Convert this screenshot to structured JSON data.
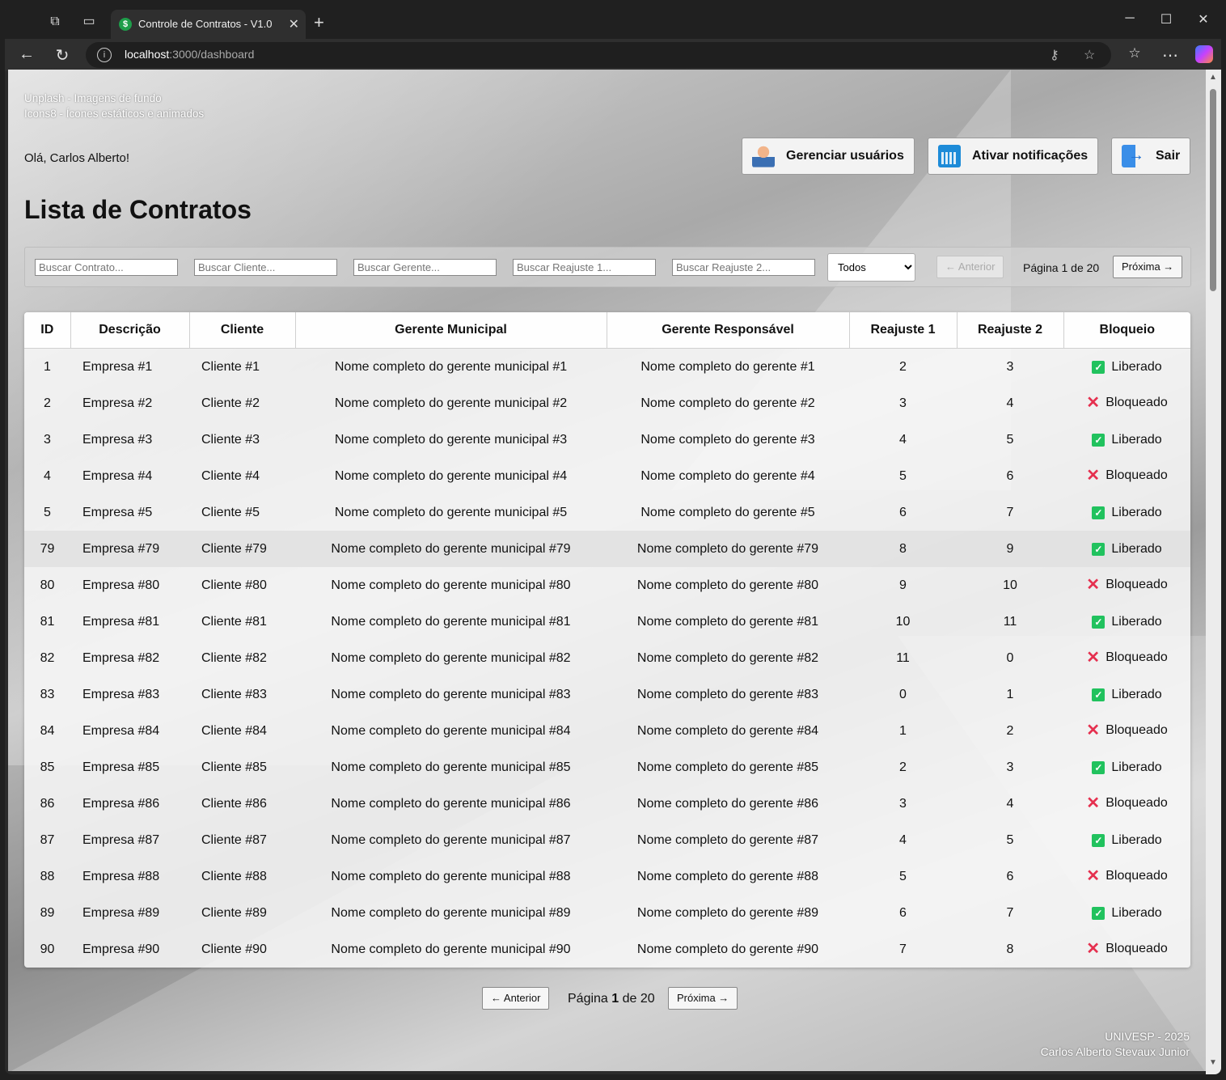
{
  "browser": {
    "tab_title": "Controle de Contratos - V1.0",
    "tab_favicon": "$",
    "url_host": "localhost",
    "url_path": ":3000/dashboard"
  },
  "credits": {
    "line1": "Unplash - Imagens de fundo",
    "line2": "Icons8 - Ícones estáticos e animados"
  },
  "greeting": "Olá, Carlos Alberto!",
  "header_buttons": {
    "users": "Gerenciar usuários",
    "notifications": "Ativar notificações",
    "logout": "Sair"
  },
  "page_title": "Lista de Contratos",
  "filters": {
    "contrato_placeholder": "Buscar Contrato...",
    "cliente_placeholder": "Buscar Cliente...",
    "gerente_placeholder": "Buscar Gerente...",
    "reajuste1_placeholder": "Buscar Reajuste 1...",
    "reajuste2_placeholder": "Buscar Reajuste 2...",
    "status_selected": "Todos"
  },
  "pagination": {
    "prev": "← Anterior",
    "next": "Próxima →",
    "label_prefix": "Página",
    "current": "1",
    "label_mid": "de",
    "total": "20",
    "text": "Página 1 de 20"
  },
  "table": {
    "headers": [
      "ID",
      "Descrição",
      "Cliente",
      "Gerente Municipal",
      "Gerente Responsável",
      "Reajuste 1",
      "Reajuste 2",
      "Bloqueio"
    ],
    "rows": [
      {
        "id": "1",
        "desc": "Empresa #1",
        "cliente": "Cliente #1",
        "gm": "Nome completo do gerente municipal #1",
        "gr": "Nome completo do gerente #1",
        "r1": "2",
        "r2": "3",
        "status": "Liberado"
      },
      {
        "id": "2",
        "desc": "Empresa #2",
        "cliente": "Cliente #2",
        "gm": "Nome completo do gerente municipal #2",
        "gr": "Nome completo do gerente #2",
        "r1": "3",
        "r2": "4",
        "status": "Bloqueado"
      },
      {
        "id": "3",
        "desc": "Empresa #3",
        "cliente": "Cliente #3",
        "gm": "Nome completo do gerente municipal #3",
        "gr": "Nome completo do gerente #3",
        "r1": "4",
        "r2": "5",
        "status": "Liberado"
      },
      {
        "id": "4",
        "desc": "Empresa #4",
        "cliente": "Cliente #4",
        "gm": "Nome completo do gerente municipal #4",
        "gr": "Nome completo do gerente #4",
        "r1": "5",
        "r2": "6",
        "status": "Bloqueado"
      },
      {
        "id": "5",
        "desc": "Empresa #5",
        "cliente": "Cliente #5",
        "gm": "Nome completo do gerente municipal #5",
        "gr": "Nome completo do gerente #5",
        "r1": "6",
        "r2": "7",
        "status": "Liberado"
      },
      {
        "id": "79",
        "desc": "Empresa #79",
        "cliente": "Cliente #79",
        "gm": "Nome completo do gerente municipal #79",
        "gr": "Nome completo do gerente #79",
        "r1": "8",
        "r2": "9",
        "status": "Liberado"
      },
      {
        "id": "80",
        "desc": "Empresa #80",
        "cliente": "Cliente #80",
        "gm": "Nome completo do gerente municipal #80",
        "gr": "Nome completo do gerente #80",
        "r1": "9",
        "r2": "10",
        "status": "Bloqueado"
      },
      {
        "id": "81",
        "desc": "Empresa #81",
        "cliente": "Cliente #81",
        "gm": "Nome completo do gerente municipal #81",
        "gr": "Nome completo do gerente #81",
        "r1": "10",
        "r2": "11",
        "status": "Liberado"
      },
      {
        "id": "82",
        "desc": "Empresa #82",
        "cliente": "Cliente #82",
        "gm": "Nome completo do gerente municipal #82",
        "gr": "Nome completo do gerente #82",
        "r1": "11",
        "r2": "0",
        "status": "Bloqueado"
      },
      {
        "id": "83",
        "desc": "Empresa #83",
        "cliente": "Cliente #83",
        "gm": "Nome completo do gerente municipal #83",
        "gr": "Nome completo do gerente #83",
        "r1": "0",
        "r2": "1",
        "status": "Liberado"
      },
      {
        "id": "84",
        "desc": "Empresa #84",
        "cliente": "Cliente #84",
        "gm": "Nome completo do gerente municipal #84",
        "gr": "Nome completo do gerente #84",
        "r1": "1",
        "r2": "2",
        "status": "Bloqueado"
      },
      {
        "id": "85",
        "desc": "Empresa #85",
        "cliente": "Cliente #85",
        "gm": "Nome completo do gerente municipal #85",
        "gr": "Nome completo do gerente #85",
        "r1": "2",
        "r2": "3",
        "status": "Liberado"
      },
      {
        "id": "86",
        "desc": "Empresa #86",
        "cliente": "Cliente #86",
        "gm": "Nome completo do gerente municipal #86",
        "gr": "Nome completo do gerente #86",
        "r1": "3",
        "r2": "4",
        "status": "Bloqueado"
      },
      {
        "id": "87",
        "desc": "Empresa #87",
        "cliente": "Cliente #87",
        "gm": "Nome completo do gerente municipal #87",
        "gr": "Nome completo do gerente #87",
        "r1": "4",
        "r2": "5",
        "status": "Liberado"
      },
      {
        "id": "88",
        "desc": "Empresa #88",
        "cliente": "Cliente #88",
        "gm": "Nome completo do gerente municipal #88",
        "gr": "Nome completo do gerente #88",
        "r1": "5",
        "r2": "6",
        "status": "Bloqueado"
      },
      {
        "id": "89",
        "desc": "Empresa #89",
        "cliente": "Cliente #89",
        "gm": "Nome completo do gerente municipal #89",
        "gr": "Nome completo do gerente #89",
        "r1": "6",
        "r2": "7",
        "status": "Liberado"
      },
      {
        "id": "90",
        "desc": "Empresa #90",
        "cliente": "Cliente #90",
        "gm": "Nome completo do gerente municipal #90",
        "gr": "Nome completo do gerente #90",
        "r1": "7",
        "r2": "8",
        "status": "Bloqueado"
      }
    ]
  },
  "footer": {
    "line1": "UNIVESP - 2025",
    "line2": "Carlos Alberto Stevaux Junior"
  },
  "colors": {
    "liberado": "#21c25e",
    "bloqueado": "#e5304f"
  }
}
